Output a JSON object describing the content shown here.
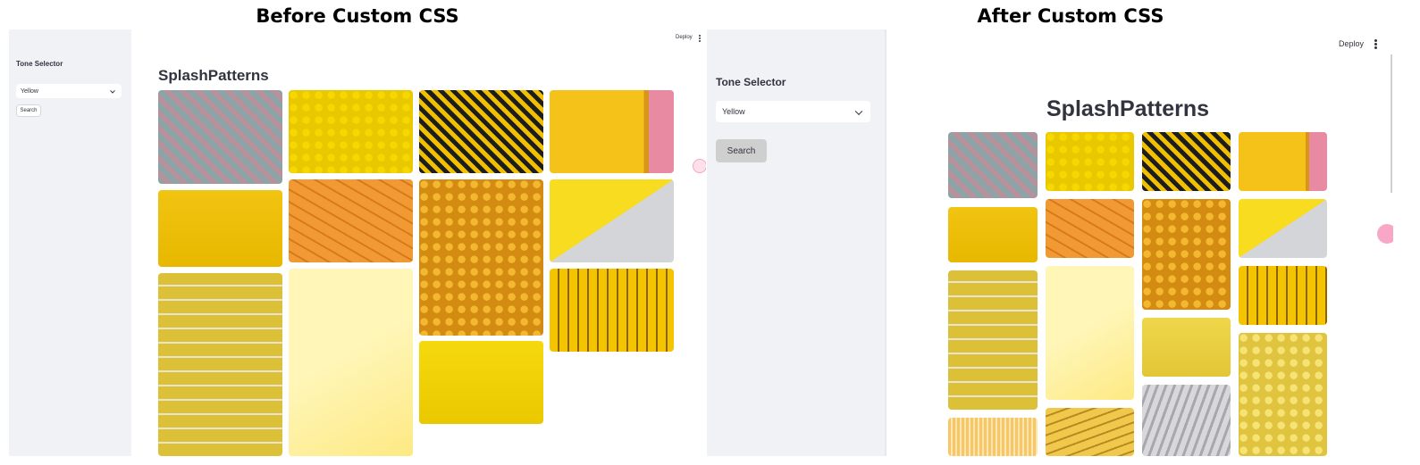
{
  "panels": {
    "before": {
      "title": "Before Custom CSS",
      "sidebar": {
        "heading": "Tone Selector",
        "select_value": "Yellow",
        "search_label": "Search"
      },
      "header": {
        "deploy_label": "Deploy"
      },
      "app_title": "SplashPatterns"
    },
    "after": {
      "title": "After Custom CSS",
      "sidebar": {
        "heading": "Tone Selector",
        "select_value": "Yellow",
        "search_label": "Search"
      },
      "header": {
        "deploy_label": "Deploy"
      },
      "app_title": "SplashPatterns"
    }
  },
  "gallery": {
    "before": [
      {
        "name": "tile-scales",
        "icon": "colorful-scales-pattern",
        "colors": [
          "#8aa4a8",
          "#b7929d"
        ]
      },
      {
        "name": "tile-balls",
        "icon": "yellow-balls",
        "colors": [
          "#f5d800",
          "#e9c800"
        ]
      },
      {
        "name": "tile-stripes",
        "icon": "black-yellow-stripes",
        "colors": [
          "#f0c000",
          "#1d1d1d"
        ]
      },
      {
        "name": "tile-yellow-pink",
        "icon": "yellow-wall-pink-edge",
        "colors": [
          "#f5c21a",
          "#e98aa3"
        ]
      },
      {
        "name": "tile-yellow-pegboard",
        "icon": "yellow-pegboard",
        "colors": [
          "#f1c412",
          "#e8b800"
        ]
      },
      {
        "name": "tile-orange-tiles",
        "icon": "orange-tiles",
        "colors": [
          "#f19a33",
          "#d9791c"
        ]
      },
      {
        "name": "tile-skulls",
        "icon": "yellow-skull-beads",
        "colors": [
          "#f4b830",
          "#d38b12"
        ]
      },
      {
        "name": "tile-diagonal",
        "icon": "yellow-grey-diagonal",
        "colors": [
          "#f7dc20",
          "#d4d5d8"
        ]
      },
      {
        "name": "tile-mosaic",
        "icon": "yellow-mosaic",
        "colors": [
          "#dcc038",
          "#b9a12b"
        ]
      },
      {
        "name": "tile-pale",
        "icon": "pale-yellow-gradient",
        "colors": [
          "#fff6b8",
          "#fde983"
        ]
      },
      {
        "name": "tile-lockers",
        "icon": "yellow-lockers",
        "colors": [
          "#f4c400",
          "#8a6400"
        ]
      },
      {
        "name": "tile-bright",
        "icon": "bright-yellow",
        "colors": [
          "#f5d90d",
          "#eac800"
        ]
      }
    ],
    "after": [
      {
        "name": "tile-scales",
        "icon": "colorful-scales-pattern",
        "colors": [
          "#8aa4a8",
          "#b7929d"
        ]
      },
      {
        "name": "tile-balls",
        "icon": "yellow-balls",
        "colors": [
          "#f5d800",
          "#e9c800"
        ]
      },
      {
        "name": "tile-stripes",
        "icon": "black-yellow-stripes",
        "colors": [
          "#f0c000",
          "#1d1d1d"
        ]
      },
      {
        "name": "tile-yellow-pink",
        "icon": "yellow-wall-pink-edge",
        "colors": [
          "#f5c21a",
          "#e98aa3"
        ]
      },
      {
        "name": "tile-yellow-pegboard",
        "icon": "yellow-pegboard",
        "colors": [
          "#f1c412",
          "#e8b800"
        ]
      },
      {
        "name": "tile-orange-tiles",
        "icon": "orange-tiles",
        "colors": [
          "#f19a33",
          "#d9791c"
        ]
      },
      {
        "name": "tile-skulls",
        "icon": "yellow-skull-beads",
        "colors": [
          "#f4b830",
          "#d38b12"
        ]
      },
      {
        "name": "tile-diagonal",
        "icon": "yellow-grey-diagonal",
        "colors": [
          "#f7dc20",
          "#d4d5d8"
        ]
      },
      {
        "name": "tile-mosaic",
        "icon": "yellow-mosaic",
        "colors": [
          "#dcc038",
          "#b9a12b"
        ]
      },
      {
        "name": "tile-pale",
        "icon": "pale-yellow-gradient",
        "colors": [
          "#fff6b8",
          "#fde983"
        ]
      },
      {
        "name": "tile-lockers",
        "icon": "yellow-lockers",
        "colors": [
          "#f4c400",
          "#8a6400"
        ]
      },
      {
        "name": "tile-mustard",
        "icon": "mustard-yellow",
        "colors": [
          "#efd64a",
          "#e2c637"
        ]
      },
      {
        "name": "tile-wavy-silver",
        "icon": "silver-foil",
        "colors": [
          "#d8d8da",
          "#a7a8ab"
        ]
      },
      {
        "name": "tile-lemons",
        "icon": "lemon-pattern",
        "colors": [
          "#f6e376",
          "#e0c33e"
        ]
      },
      {
        "name": "tile-stripes-pale",
        "icon": "pale-orange-stripes",
        "colors": [
          "#f7c766",
          "#fbe6b3"
        ]
      },
      {
        "name": "tile-bananas",
        "icon": "bananas",
        "colors": [
          "#f0c84c",
          "#b98a20"
        ]
      }
    ]
  },
  "colors": {
    "sidebar_bg": "#f0f2f6",
    "text": "#31333f",
    "search_button_after": "#cfcfcf"
  },
  "icons": {
    "chevron": "chevron-down-icon",
    "menu": "kebab-menu-icon",
    "floating": "floating-action-icon"
  }
}
